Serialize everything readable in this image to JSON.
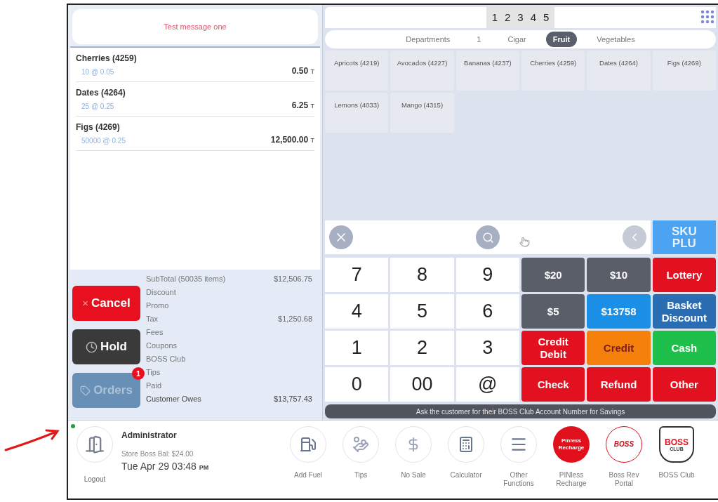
{
  "message": "Test message one",
  "order_items": [
    {
      "name": "Cherries (4259)",
      "detail": "10 @ 0.05",
      "amount": "0.50",
      "tax_mark": "T"
    },
    {
      "name": "Dates (4264)",
      "detail": "25 @ 0.25",
      "amount": "6.25",
      "tax_mark": "T"
    },
    {
      "name": "Figs (4269)",
      "detail": "50000 @ 0.25",
      "amount": "12,500.00",
      "tax_mark": "T"
    }
  ],
  "totals": [
    {
      "label": "SubTotal (50035 items)",
      "value": "$12,506.75",
      "kind": "normal"
    },
    {
      "label": "Discount",
      "kind": "normal"
    },
    {
      "label": "Promo",
      "kind": "normal"
    },
    {
      "label": "Tax",
      "value": "$1,250.68",
      "kind": "normal"
    },
    {
      "label": "Fees",
      "kind": "normal"
    },
    {
      "label": "Coupons",
      "kind": "normal"
    },
    {
      "label": "BOSS Club",
      "kind": "normal"
    },
    {
      "label": "Tips",
      "kind": "normal"
    },
    {
      "label": "Paid",
      "kind": "normal"
    },
    {
      "label": "Customer Owes",
      "value": "$13,757.43",
      "kind": "total"
    }
  ],
  "actions": [
    {
      "label": "Cancel",
      "kind": "cancel",
      "icon_text": "×"
    },
    {
      "label": "Hold",
      "kind": "hold"
    },
    {
      "label": "Orders",
      "kind": "orders",
      "badge": "1",
      "disabled": true
    }
  ],
  "page_numbers": [
    "1",
    "2",
    "3",
    "4",
    "5"
  ],
  "departments": [
    {
      "label": "Departments",
      "selected": false
    },
    {
      "label": "1",
      "selected": false
    },
    {
      "label": "Cigar",
      "selected": false
    },
    {
      "label": "Fruit",
      "selected": true
    },
    {
      "label": "Vegetables",
      "selected": false
    }
  ],
  "products": [
    "Apricots (4219)",
    "Avocados (4227)",
    "Bananas (4237)",
    "Cherries (4259)",
    "Dates (4264)",
    "Figs (4269)",
    "Lemons (4033)",
    "Mango (4315)"
  ],
  "sku_button": "SKU PLU",
  "keypad": [
    "7",
    "8",
    "9",
    "4",
    "5",
    "6",
    "1",
    "2",
    "3",
    "0",
    "00",
    "@"
  ],
  "tenders": [
    {
      "label": "$20",
      "color": "#595e68",
      "dark_label": false
    },
    {
      "label": "$10",
      "color": "#595e68",
      "dark_label": false
    },
    {
      "label": "Lottery",
      "color": "#e3101f",
      "dark_label": false
    },
    {
      "label": "$5",
      "color": "#595e68",
      "dark_label": false
    },
    {
      "label": "$13758",
      "color": "#1b8fe6",
      "dark_label": false
    },
    {
      "label": "Basket Discount",
      "color": "#2a6db2",
      "dark_label": false
    },
    {
      "label": "Credit Debit",
      "color": "#e3101f",
      "dark_label": false
    },
    {
      "label": "Credit",
      "color": "#f5800c",
      "dark_label": true
    },
    {
      "label": "Cash",
      "color": "#1fbf4c",
      "dark_label": false
    },
    {
      "label": "Check",
      "color": "#e3101f",
      "dark_label": false
    },
    {
      "label": "Refund",
      "color": "#e3101f",
      "dark_label": false
    },
    {
      "label": "Other",
      "color": "#e3101f",
      "dark_label": false
    }
  ],
  "banner": "Ask the customer for their BOSS Club Account Number for Savings",
  "footer": {
    "online": true,
    "logout": "Logout",
    "user": "Administrator",
    "balance": "Store Boss Bal: $24.00",
    "datetime": "Tue Apr 29 03:48",
    "meridiem": "PM",
    "functions": [
      {
        "label": "Add Fuel",
        "kind": "fuel"
      },
      {
        "label": "Tips",
        "kind": "tips"
      },
      {
        "label": "No Sale",
        "kind": "nosale"
      },
      {
        "label": "Calculator",
        "kind": "calculator"
      },
      {
        "label": "Other Functions",
        "kind": "menu"
      },
      {
        "label": "PINless Recharge",
        "kind": "pinless",
        "logo_text": "Pinless Recharge"
      },
      {
        "label": "Boss Rev Portal",
        "kind": "bossrev",
        "logo_text": "BOSS"
      },
      {
        "label": "BOSS Club",
        "kind": "bossclub",
        "logo_text": "BOSS",
        "logo_subtext": "CLUB"
      }
    ]
  }
}
